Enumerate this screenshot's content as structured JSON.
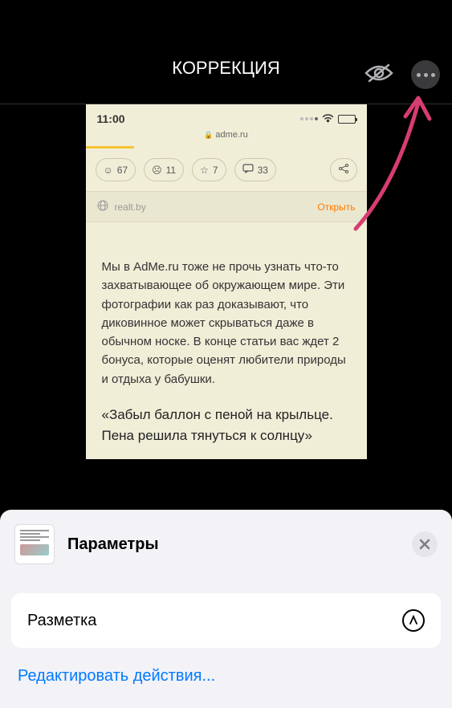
{
  "header": {
    "title": "КОРРЕКЦИЯ"
  },
  "screenshot": {
    "time": "11:00",
    "url": "adme.ru",
    "reactions": {
      "smile": "67",
      "sad": "11",
      "star": "7",
      "comments": "33"
    },
    "linkbar": {
      "site": "realt.by",
      "open": "Открыть"
    },
    "article_text": "Мы в AdMe.ru тоже не прочь узнать что-то захватывающее об окружающем мире. Эти фотографии как раз доказывают, что диковинное может скрываться даже в обычном носке. В конце статьи вас ждет 2 бонуса, которые оценят любители природы и отдыха у бабушки.",
    "article_heading": "«Забыл баллон с пеной на крыльце. Пена решила тянуться к солнцу»"
  },
  "sheet": {
    "title": "Параметры",
    "markup": "Разметка",
    "edit_actions": "Редактировать действия..."
  },
  "colors": {
    "annotation": "#d63d72"
  }
}
